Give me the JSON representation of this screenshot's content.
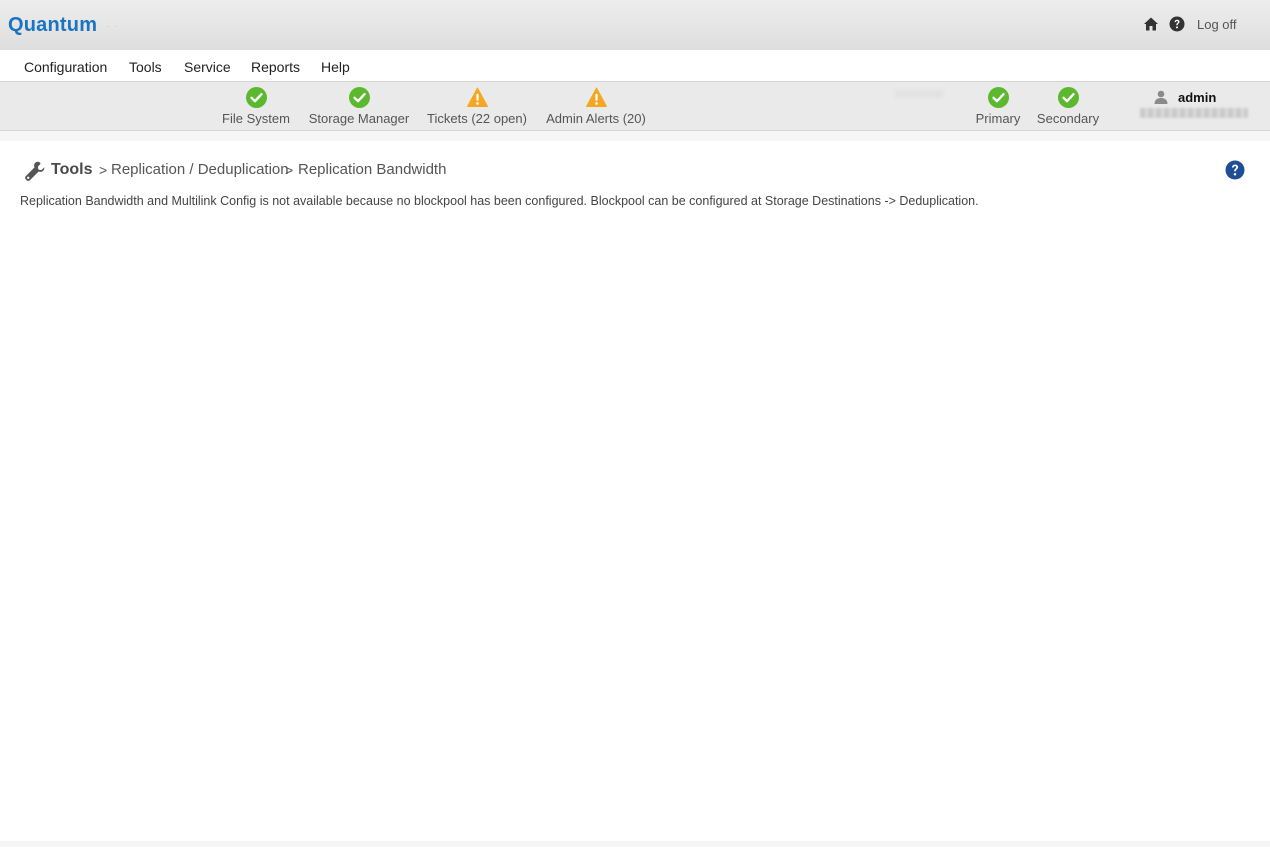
{
  "brand": {
    "logo_text": "Quantum",
    "logo_color": "#1a74c2"
  },
  "header": {
    "home_icon": "home-icon",
    "help_icon": "question-circle-icon",
    "logoff_label": "Log off"
  },
  "menu": {
    "items": [
      {
        "label": "Configuration"
      },
      {
        "label": "Tools"
      },
      {
        "label": "Service"
      },
      {
        "label": "Reports"
      },
      {
        "label": "Help"
      }
    ]
  },
  "status": {
    "items": [
      {
        "label": "File System",
        "state": "ok",
        "icon": "check-circle-icon"
      },
      {
        "label": "Storage Manager",
        "state": "ok",
        "icon": "check-circle-icon"
      },
      {
        "label": "Tickets (22 open)",
        "state": "warning",
        "icon": "warning-triangle-icon"
      },
      {
        "label": "Admin Alerts (20)",
        "state": "warning",
        "icon": "warning-triangle-icon"
      },
      {
        "label": "Primary",
        "state": "ok",
        "icon": "check-circle-icon"
      },
      {
        "label": "Secondary",
        "state": "ok",
        "icon": "check-circle-icon"
      }
    ],
    "colors": {
      "ok": "#5cb82e",
      "warning": "#f5a623"
    }
  },
  "user": {
    "name": "admin",
    "icon": "user-icon"
  },
  "breadcrumb": {
    "root": "Tools",
    "separator": ">",
    "level1": "Replication / Deduplication",
    "level2": "Replication Bandwidth"
  },
  "page": {
    "help_icon": "help-circle-icon",
    "help_color": "#1f4e96",
    "message": "Replication Bandwidth and Multilink Config is not available because no blockpool has been configured. Blockpool can be configured at Storage Destinations -> Deduplication."
  }
}
